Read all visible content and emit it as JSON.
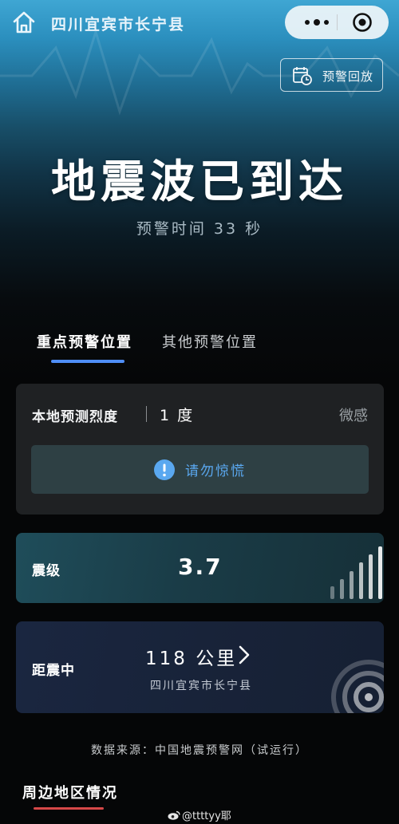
{
  "header": {
    "location": "四川宜宾市长宁县",
    "home_icon": "home-icon",
    "more_icon": "more-dots-icon",
    "close_icon": "target-circle-icon"
  },
  "replay_button": {
    "label": "预警回放",
    "icon": "calendar-clock-icon"
  },
  "alert": {
    "headline": "地震波已到达",
    "warning_time": "预警时间 33 秒"
  },
  "tabs": [
    {
      "label": "重点预警位置",
      "active": true
    },
    {
      "label": "其他预警位置",
      "active": false
    }
  ],
  "intensity_card": {
    "label": "本地预测烈度",
    "value": "1 度",
    "description": "微感",
    "notice": {
      "icon": "exclamation-circle-icon",
      "text": "请勿惊慌"
    }
  },
  "magnitude_card": {
    "label": "震级",
    "value": "3.7",
    "icon": "signal-bars-icon"
  },
  "distance_card": {
    "label": "距震中",
    "value": "118 公里",
    "place": "四川宜宾市长宁县",
    "arrow_icon": "chevron-right-icon",
    "rings_icon": "concentric-rings-icon"
  },
  "footer": {
    "source": "数据来源：中国地震预警网（试运行）",
    "section_title": "周边地区情况",
    "watermark": "@ttttyy耶"
  },
  "colors": {
    "tab_underline": "#4f8ef7",
    "notice_text": "#5aa8f0",
    "section_underline": "#d64848"
  }
}
